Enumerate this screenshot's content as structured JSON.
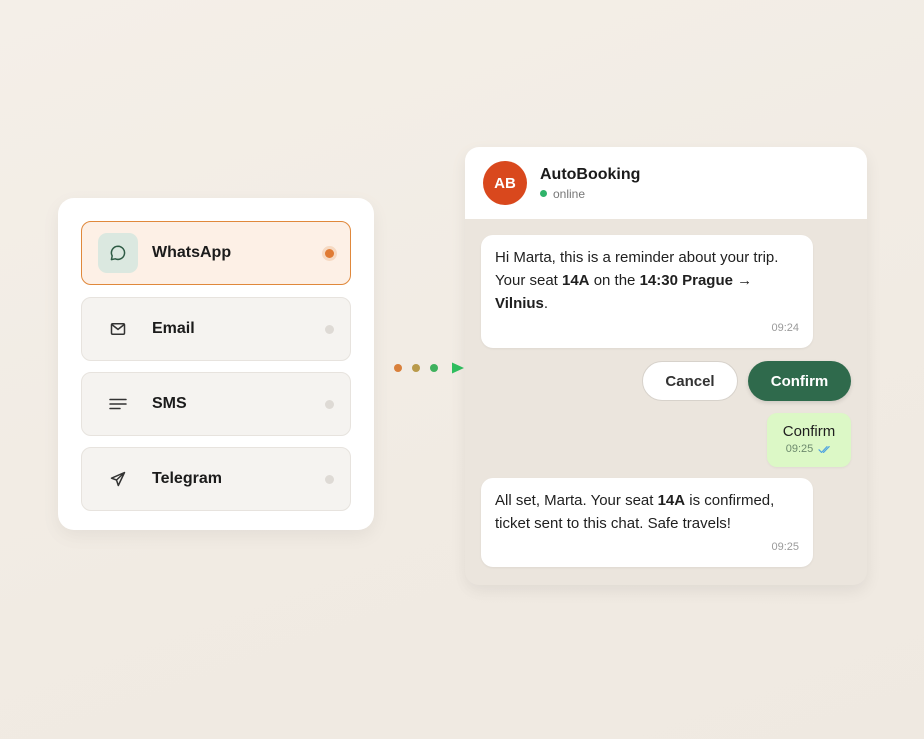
{
  "channels": [
    {
      "label": "WhatsApp",
      "icon": "chat-bubble-icon",
      "active": true
    },
    {
      "label": "Email",
      "icon": "envelope-icon",
      "active": false
    },
    {
      "label": "SMS",
      "icon": "lines-icon",
      "active": false
    },
    {
      "label": "Telegram",
      "icon": "paper-plane-icon",
      "active": false
    }
  ],
  "chat": {
    "avatar_initials": "AB",
    "name": "AutoBooking",
    "status": "online",
    "message1": {
      "line1": "Hi Marta, this is a reminder about your trip.",
      "line2_pre": "Your seat ",
      "seat": "14A",
      "line2_mid": " on the ",
      "trip": "14:30 Prague →",
      "trip_end": "Vilnius",
      "line3_post": ".",
      "time": "09:24"
    },
    "cancel_label": "Cancel",
    "confirm_label": "Confirm",
    "sent": {
      "text": "Confirm",
      "time": "09:25"
    },
    "message2": {
      "pre": "All set, Marta. Your seat ",
      "seat": "14A",
      "post": " is confirmed,",
      "line2": "ticket sent to this chat. Safe travels!",
      "time": "09:25"
    }
  },
  "colors": {
    "accent_orange": "#e07b34",
    "avatar": "#d9481d",
    "confirm_green": "#2f6a4c",
    "online_green": "#2fb36a"
  }
}
